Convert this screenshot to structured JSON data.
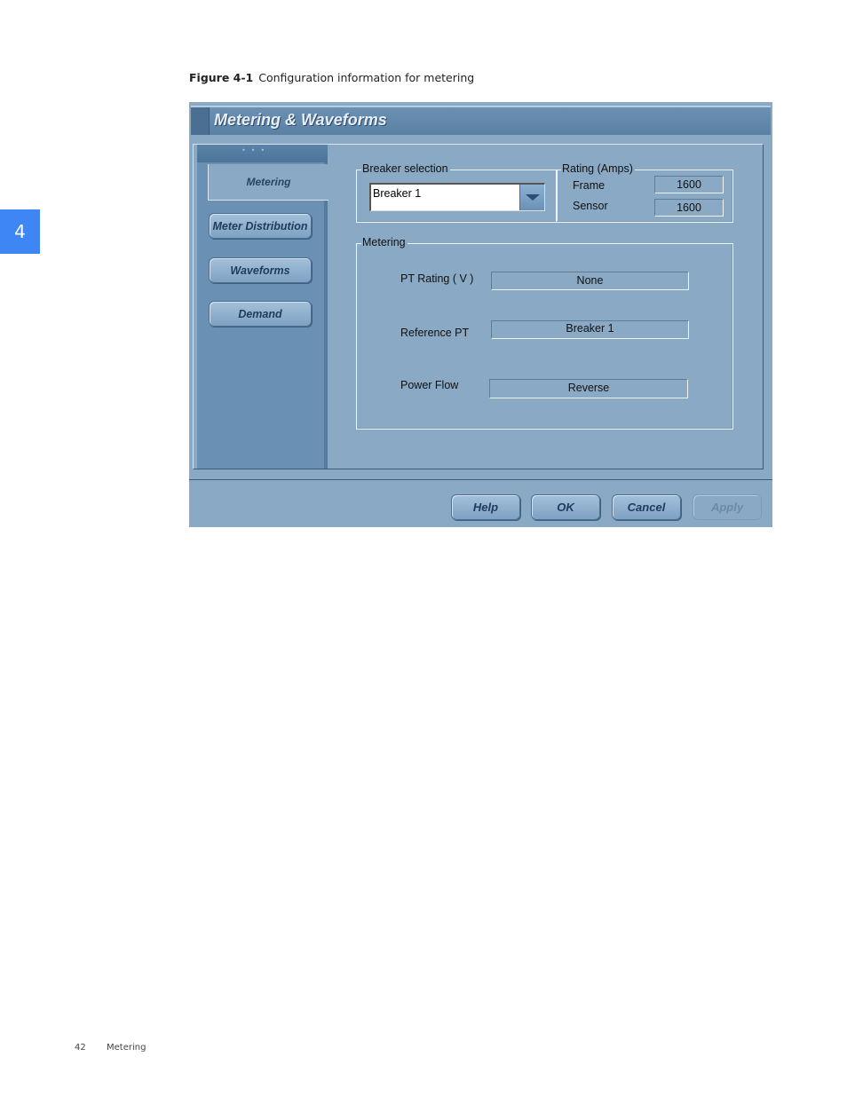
{
  "page": {
    "chapter_number": "4",
    "figure_label": "Figure 4-1",
    "figure_caption": "Configuration information for metering",
    "footer_page": "42",
    "footer_section": "Metering"
  },
  "dialog": {
    "title": "Metering & Waveforms",
    "sidebar": {
      "active_tab": "Metering",
      "buttons": [
        "Meter Distribution",
        "Waveforms",
        "Demand"
      ]
    },
    "breaker_selection": {
      "label": "Breaker selection",
      "selected": "Breaker 1"
    },
    "rating": {
      "label": "Rating (Amps)",
      "frame_label": "Frame",
      "frame_value": "1600",
      "sensor_label": "Sensor",
      "sensor_value": "1600"
    },
    "metering": {
      "label": "Metering",
      "pt_rating_label": "PT Rating ( V )",
      "pt_rating_value": "None",
      "reference_pt_label": "Reference PT",
      "reference_pt_value": "Breaker 1",
      "power_flow_label": "Power Flow",
      "power_flow_value": "Reverse"
    },
    "buttons": {
      "help": "Help",
      "ok": "OK",
      "cancel": "Cancel",
      "apply": "Apply"
    }
  }
}
